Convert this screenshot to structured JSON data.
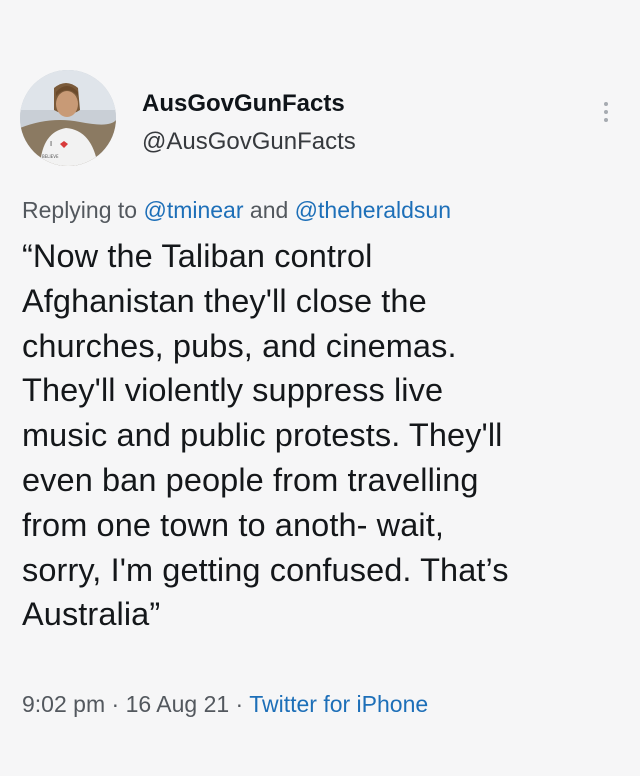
{
  "user": {
    "display_name": "AusGovGunFacts",
    "handle": "@AusGovGunFacts"
  },
  "reply": {
    "prefix": "Replying to ",
    "mention1": "@tminear",
    "conjunction": " and ",
    "mention2": "@theheraldsun"
  },
  "tweet": {
    "text": "“Now the Taliban control\nAfghanistan they'll close the\nchurches, pubs, and cinemas.\nThey'll violently suppress live\nmusic and public protests. They'll\neven ban people from travelling\nfrom one town to anoth- wait,\nsorry, I'm getting confused. That’s\nAustralia”"
  },
  "meta": {
    "time": "9:02 pm",
    "sep1": " · ",
    "date": "16 Aug 21",
    "sep2": " · ",
    "source": "Twitter for iPhone"
  },
  "icons": {
    "more": "more-vertical-icon",
    "avatar": "avatar-image"
  },
  "colors": {
    "link": "#1d6fb8",
    "secondary": "#53585e",
    "text": "#14171a",
    "background": "#f6f6f7"
  }
}
